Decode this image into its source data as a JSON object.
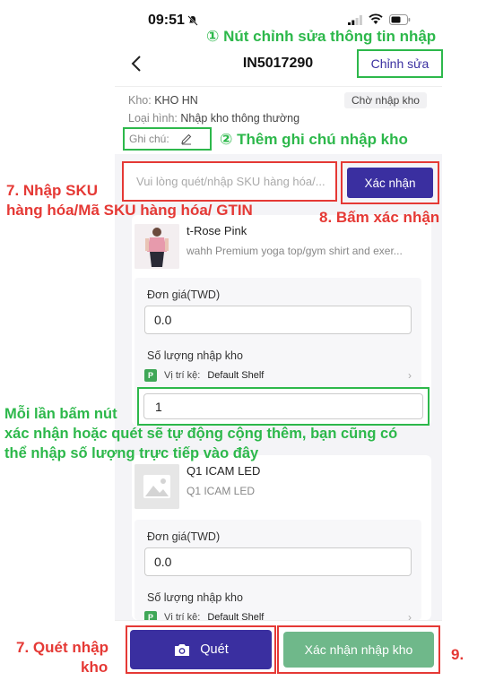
{
  "status_bar": {
    "time": "09:51"
  },
  "header": {
    "title": "IN5017290",
    "edit_label": "Chỉnh sửa"
  },
  "info": {
    "warehouse_label": "Kho:",
    "warehouse_value": "KHO HN",
    "status": "Chờ nhập kho",
    "type_label": "Loại hình:",
    "type_value": "Nhập kho thông thường",
    "note_label": "Ghi chú:"
  },
  "scan": {
    "placeholder": "Vui lòng quét/nhập SKU hàng hóa/...",
    "confirm_label": "Xác nhận"
  },
  "products": [
    {
      "name": "t-Rose Pink",
      "desc": "wahh Premium yoga top/gym shirt and exer...",
      "price_label": "Đơn giá(TWD)",
      "price": "0.0",
      "qty_label": "Số lượng nhập kho",
      "shelf_label": "Vị trí kệ:",
      "shelf_value": "Default Shelf",
      "qty": "1"
    },
    {
      "name": "Q1 ICAM LED",
      "desc": "Q1 ICAM LED",
      "price_label": "Đơn giá(TWD)",
      "price": "0.0",
      "qty_label": "Số lượng nhập kho",
      "shelf_label": "Vị trí kệ:",
      "shelf_value": "Default Shelf"
    }
  ],
  "bottom": {
    "scan_label": "Quét",
    "confirm_stock_label": "Xác nhận nhập kho"
  },
  "annotations": {
    "a1": "① Nút chỉnh sửa thông tin nhập",
    "a2": "② Thêm ghi chú nhập kho",
    "a7_line1": "7. Nhập SKU",
    "a7_line2": "hàng hóa/Mã SKU hàng hóa/ GTIN",
    "a8": "8. Bấm xác nhận",
    "qty_line1": "Mỗi lần bấm nút",
    "qty_line2": "xác nhận hoặc quét sẽ tự động cộng thêm, bạn cũng có",
    "qty_line3": "thể nhập số lượng trực tiếp vào đây",
    "scan_line1": "7. Quét nhập",
    "scan_line2": "kho",
    "a9": "9."
  },
  "colors": {
    "primary": "#3a2fa0",
    "confirm_stock": "#6fb88a",
    "annotation_green": "#2db84b",
    "annotation_red": "#e53935",
    "shelf_badge": "#3fa757"
  },
  "icons": [
    "bell-slash-icon",
    "signal-icon",
    "wifi-icon",
    "battery-icon",
    "back-arrow-icon",
    "pencil-icon",
    "camera-icon",
    "chevron-right-icon",
    "image-placeholder-icon"
  ]
}
